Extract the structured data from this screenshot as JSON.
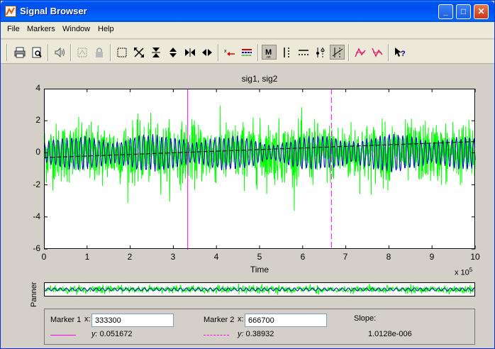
{
  "window": {
    "title": "Signal Browser",
    "buttons": {
      "minimize": "_",
      "maximize": "□",
      "close": "✕"
    }
  },
  "menu": [
    "File",
    "Markers",
    "Window",
    "Help"
  ],
  "toolbar": {
    "icons": [
      "print-icon",
      "print-preview-icon",
      "play-sound-icon",
      "select-all-icon",
      "lock-icon",
      "zoom-box-icon",
      "zoom-out-full-icon",
      "zoom-out-vertical-icon",
      "zoom-in-vertical-icon",
      "zoom-out-horizontal-icon",
      "zoom-in-horizontal-icon",
      "delete-marker-icon",
      "color-lines-icon",
      "marker-mode-icon",
      "vertical-markers-icon",
      "horizontal-markers-icon",
      "track-markers-icon",
      "slope-markers-icon",
      "peaks-icon",
      "valleys-icon",
      "whats-this-icon"
    ]
  },
  "chart_data": {
    "type": "line",
    "title": "sig1, sig2",
    "xlabel": "Time",
    "x_exponent_label": "x 10",
    "x_exponent_power": "5",
    "xlim": [
      0,
      10
    ],
    "ylim": [
      -6,
      4
    ],
    "xticks": [
      "0",
      "1",
      "2",
      "3",
      "4",
      "5",
      "6",
      "7",
      "8",
      "9",
      "10"
    ],
    "yticks": [
      "4",
      "2",
      "0",
      "-2",
      "-4",
      "-6"
    ],
    "series": [
      {
        "color": "#00ff00",
        "note_amplitude": 1.0
      },
      {
        "color": "#0000c0",
        "note_amplitude": 0.5
      }
    ],
    "markers": [
      {
        "x": 3.333,
        "style": "solid",
        "color": "#ff00ff"
      },
      {
        "x": 6.667,
        "style": "dash",
        "color": "#ff00ff"
      }
    ]
  },
  "panner": {
    "label": "Panner"
  },
  "marker_panel": {
    "marker1_label": "Marker 1",
    "marker1_x_label": "x:",
    "marker1_x": "333300",
    "marker1_y_label": "y:",
    "marker1_y": "0.051672",
    "marker2_label": "Marker 2",
    "marker2_x_label": "x:",
    "marker2_x": "666700",
    "marker2_y_label": "y:",
    "marker2_y": "0.38932",
    "slope_label": "Slope:",
    "slope_value": "1.0128e-006"
  }
}
